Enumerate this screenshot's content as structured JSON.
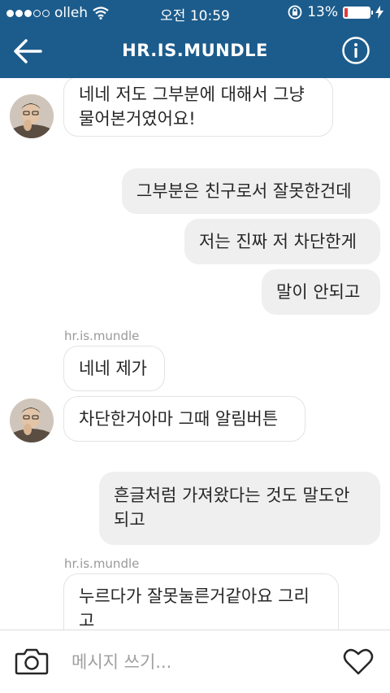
{
  "status": {
    "carrier": "olleh",
    "time": "오전 10:59",
    "battery": "13%",
    "battery_level": 0.13
  },
  "header": {
    "title": "HR.IS.MUNDLE"
  },
  "messages": {
    "m1_line1": "네네 저도 그부분에 대해서 그냥",
    "m1_line2": "물어본거였어요!",
    "m2": "그부분은 친구로서 잘못한건데",
    "m3": "저는 진짜 저 차단한게",
    "m4": "말이 안되고",
    "sender1": "hr.is.mundle",
    "m5": "네네 제가",
    "m6": "차단한거아마 그때 알림버튼",
    "m7_line1": "흔글처럼 가져왔다는 것도 말도안",
    "m7_line2": "되고",
    "sender2": "hr.is.mundle",
    "m8_line1": "누르다가 잘못눌른거같아요 그리",
    "m8_line2": "고"
  },
  "composer": {
    "placeholder": "메시지 쓰기..."
  },
  "colors": {
    "header_bg": "#1c5c8c",
    "battery_low": "#e23b3b"
  }
}
